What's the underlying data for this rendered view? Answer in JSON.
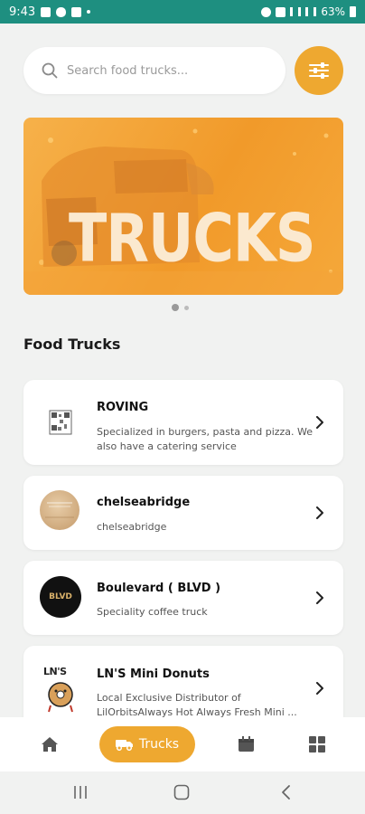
{
  "status_bar": {
    "time": "9:43",
    "battery": "63%"
  },
  "search": {
    "placeholder": "Search food trucks..."
  },
  "icons": {
    "search": "search-icon",
    "filter": "sliders-icon",
    "chevron": "chevron-right-icon",
    "home": "home-icon",
    "truck": "truck-icon",
    "calendar": "calendar-icon",
    "grid": "grid-icon"
  },
  "banner": {
    "title": "TRUCKS"
  },
  "section": {
    "title": "Food Trucks"
  },
  "trucks": [
    {
      "name": "ROVING",
      "description": "Specialized in burgers, pasta and pizza. We also have a catering service"
    },
    {
      "name": "chelseabridge",
      "description": "chelseabridge"
    },
    {
      "name": "Boulevard ( BLVD )",
      "description": "Speciality coffee truck",
      "logo_text": "BLVD"
    },
    {
      "name": "LN'S Mini Donuts",
      "description": "Local Exclusive Distributor of LilOrbitsAlways Hot Always Fresh Mini ...",
      "logo_text": "LN'S"
    }
  ],
  "bottom_nav": {
    "active_label": "Trucks"
  },
  "colors": {
    "accent": "#eea830",
    "status_bar": "#1e8f80"
  }
}
